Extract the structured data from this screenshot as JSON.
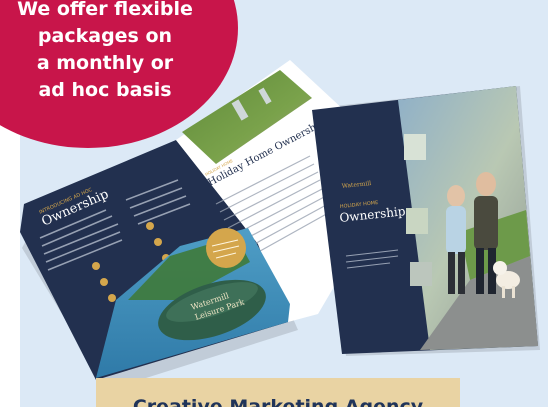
{
  "callout": {
    "lines": [
      "We offer flexible",
      "packages on",
      "a monthly or",
      "ad hoc basis"
    ]
  },
  "banner": {
    "label": "Creative Marketing Agency"
  },
  "brochure_back": {
    "heading": "Ownership",
    "subheading": "INTRODUCING AD HOC"
  },
  "brochure_spread": {
    "heading": "Holiday Home Ownership",
    "kicker": "HOLIDAY HOME",
    "sign_line1": "Watermill",
    "sign_line2": "Leisure Park"
  },
  "brochure_cover": {
    "brand": "Watermill",
    "kicker": "HOLIDAY HOME",
    "title": "Ownership"
  },
  "colors": {
    "panel": "#dce9f6",
    "callout": "#c8154a",
    "banner": "#e9d3a3",
    "banner_text": "#20345a",
    "navy": "#22304f",
    "gold": "#d4a64c"
  }
}
